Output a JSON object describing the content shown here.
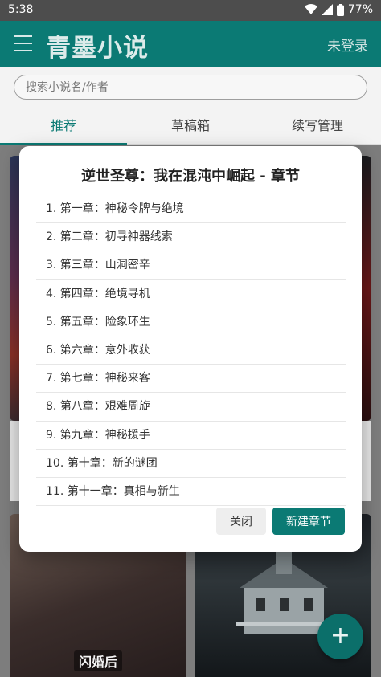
{
  "status_bar": {
    "time": "5:38",
    "battery": "77%",
    "icons": [
      "wifi-icon",
      "signal-icon",
      "battery-icon"
    ]
  },
  "app_bar": {
    "title": "青墨小说",
    "login_label": "未登录",
    "menu_icon": "hamburger-menu-icon",
    "color": "#0b7a74"
  },
  "search": {
    "placeholder": "搜索小说名/作者"
  },
  "tabs": [
    {
      "label": "推荐",
      "active": true
    },
    {
      "label": "草稿箱",
      "active": false
    },
    {
      "label": "续写管理",
      "active": false
    }
  ],
  "cards": {
    "cover3_text": "闪婚后"
  },
  "dialog": {
    "title": "逆世圣尊：我在混沌中崛起 - 章节",
    "chapters": [
      "1. 第一章：神秘令牌与绝境",
      "2. 第二章：初寻神器线索",
      "3. 第三章：山洞密辛",
      "4. 第四章：绝境寻机",
      "5. 第五章：险象环生",
      "6. 第六章：意外收获",
      "7. 第七章：神秘来客",
      "8. 第八章：艰难周旋",
      "9. 第九章：神秘援手",
      "10. 第十章：新的谜团",
      "11. 第十一章：真相与新生"
    ],
    "close_label": "关闭",
    "new_chapter_label": "新建章节"
  },
  "fab": {
    "label": "+",
    "icon": "add-icon"
  }
}
